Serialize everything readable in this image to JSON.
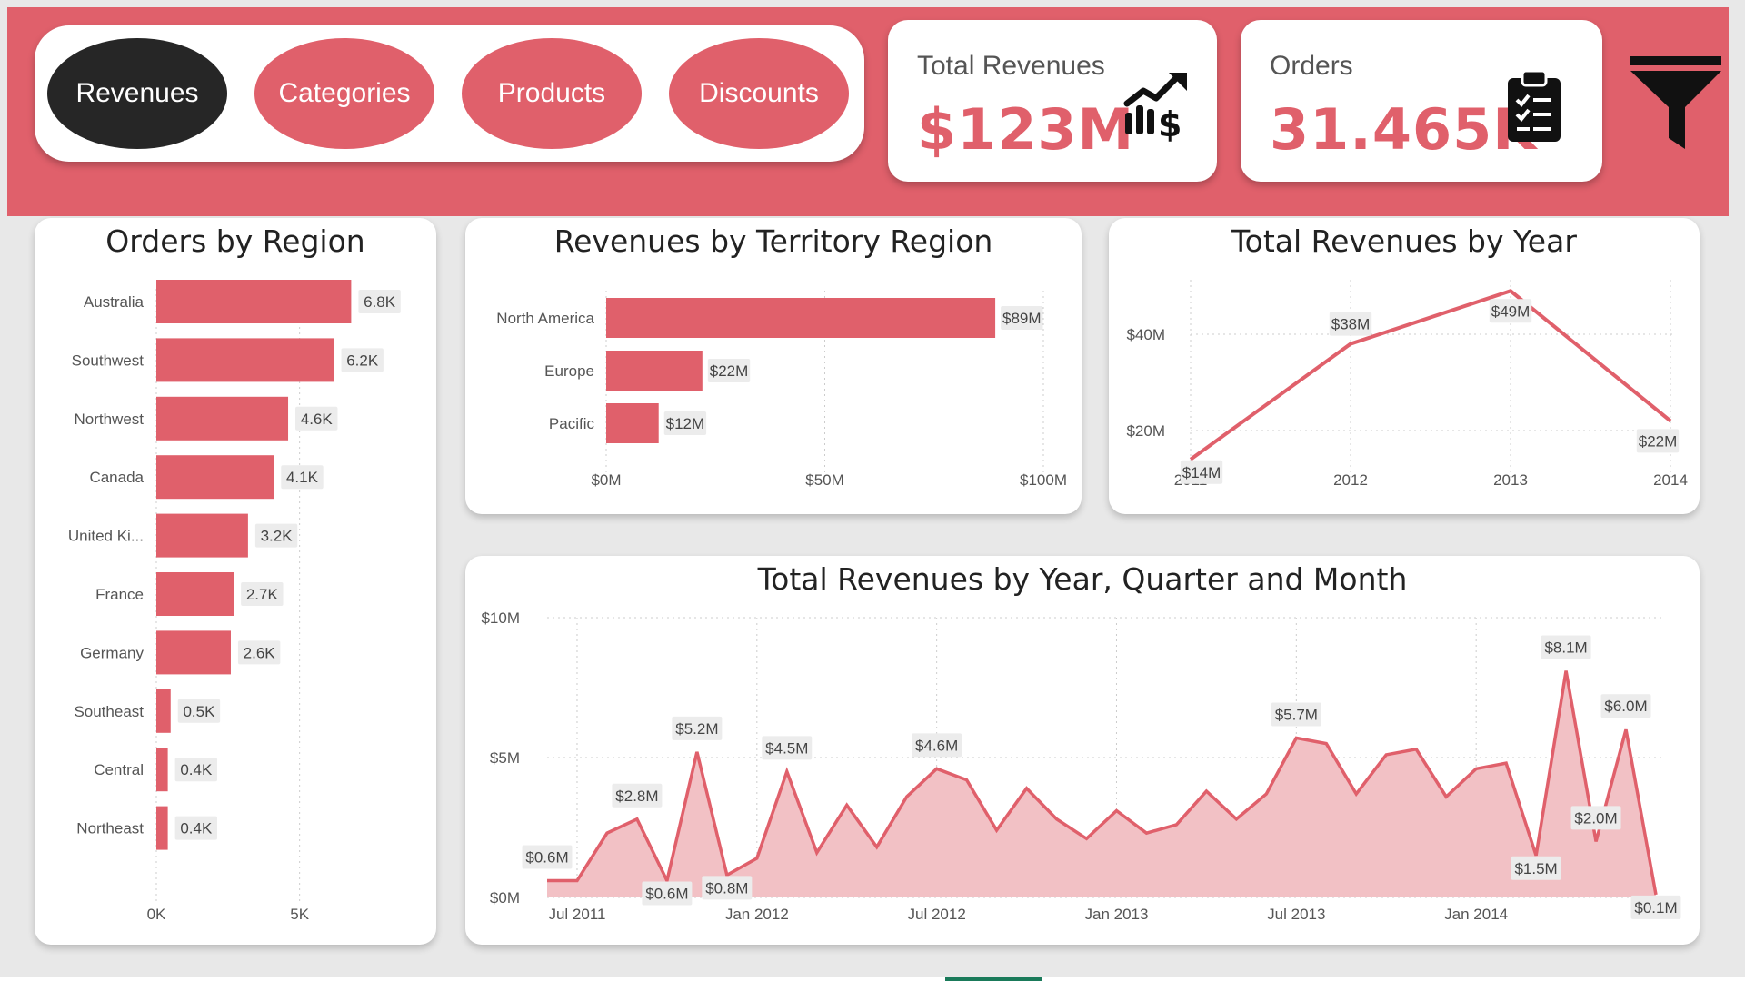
{
  "nav": {
    "buttons": [
      {
        "label": "Revenues",
        "active": true
      },
      {
        "label": "Categories",
        "active": false
      },
      {
        "label": "Products",
        "active": false
      },
      {
        "label": "Discounts",
        "active": false
      }
    ]
  },
  "kpis": {
    "revenue": {
      "label": "Total Revenues",
      "value": "$123M",
      "icon": "revenue-chart-dollar-icon"
    },
    "orders": {
      "label": "Orders",
      "value": "31.465K",
      "icon": "clipboard-checklist-icon"
    }
  },
  "filter": {
    "icon": "funnel-filter-icon"
  },
  "colors": {
    "accent": "#e0606b",
    "active_button": "#262626",
    "area_fill": "#f2c1c5",
    "label_bg": "#ececec"
  },
  "chart_data": [
    {
      "type": "bar",
      "orientation": "horizontal",
      "title": "Orders by Region",
      "categories": [
        "Australia",
        "Southwest",
        "Northwest",
        "Canada",
        "United Ki...",
        "France",
        "Germany",
        "Southeast",
        "Central",
        "Northeast"
      ],
      "values": [
        6.8,
        6.2,
        4.6,
        4.1,
        3.2,
        2.7,
        2.6,
        0.5,
        0.4,
        0.4
      ],
      "value_labels": [
        "6.8K",
        "6.2K",
        "4.6K",
        "4.1K",
        "3.2K",
        "2.7K",
        "2.6K",
        "0.5K",
        "0.4K",
        "0.4K"
      ],
      "x_ticks": [
        "0K",
        "5K"
      ],
      "x_tick_values": [
        0,
        5
      ],
      "xlim": [
        0,
        8.5
      ],
      "grid": true
    },
    {
      "type": "bar",
      "orientation": "horizontal",
      "title": "Revenues by Territory Region",
      "categories": [
        "North America",
        "Europe",
        "Pacific"
      ],
      "values": [
        89,
        22,
        12
      ],
      "value_labels": [
        "$89M",
        "$22M",
        "$12M"
      ],
      "x_ticks": [
        "$0M",
        "$50M",
        "$100M"
      ],
      "x_tick_values": [
        0,
        50,
        100
      ],
      "xlim": [
        0,
        100
      ],
      "grid": true
    },
    {
      "type": "line",
      "title": "Total Revenues by Year",
      "x": [
        "2011",
        "2012",
        "2013",
        "2014"
      ],
      "values": [
        14,
        38,
        49,
        22
      ],
      "value_labels": [
        "$14M",
        "$38M",
        "$49M",
        "$22M"
      ],
      "y_ticks": [
        "$20M",
        "$40M"
      ],
      "y_tick_values": [
        20,
        40
      ],
      "ylim": [
        10,
        50
      ],
      "grid": true
    },
    {
      "type": "area",
      "title": "Total Revenues by Year, Quarter and Month",
      "x_ticks": [
        "Jul 2011",
        "Jan 2012",
        "Jul 2012",
        "Jan 2013",
        "Jul 2013",
        "Jan 2014"
      ],
      "x_tick_index": [
        1,
        7,
        13,
        19,
        25,
        31
      ],
      "values": [
        0.6,
        0.6,
        2.3,
        2.8,
        0.6,
        5.2,
        0.8,
        1.4,
        4.5,
        1.6,
        3.3,
        1.8,
        3.6,
        4.6,
        4.2,
        2.4,
        3.9,
        2.8,
        2.1,
        3.1,
        2.3,
        2.6,
        3.8,
        2.8,
        3.7,
        5.7,
        5.5,
        3.7,
        5.1,
        5.3,
        3.6,
        4.6,
        4.8,
        1.5,
        8.1,
        2.0,
        6.0,
        0.1
      ],
      "labels": [
        {
          "index": 0,
          "text": "$0.6M"
        },
        {
          "index": 3,
          "text": "$2.8M"
        },
        {
          "index": 4,
          "text": "$0.6M"
        },
        {
          "index": 5,
          "text": "$5.2M"
        },
        {
          "index": 6,
          "text": "$0.8M"
        },
        {
          "index": 8,
          "text": "$4.5M"
        },
        {
          "index": 13,
          "text": "$4.6M"
        },
        {
          "index": 25,
          "text": "$5.7M"
        },
        {
          "index": 33,
          "text": "$1.5M"
        },
        {
          "index": 34,
          "text": "$8.1M"
        },
        {
          "index": 35,
          "text": "$2.0M"
        },
        {
          "index": 36,
          "text": "$6.0M"
        },
        {
          "index": 37,
          "text": "$0.1M"
        }
      ],
      "y_ticks": [
        "$0M",
        "$5M",
        "$10M"
      ],
      "y_tick_values": [
        0,
        5,
        10
      ],
      "ylim": [
        0,
        10
      ],
      "grid": true
    }
  ]
}
